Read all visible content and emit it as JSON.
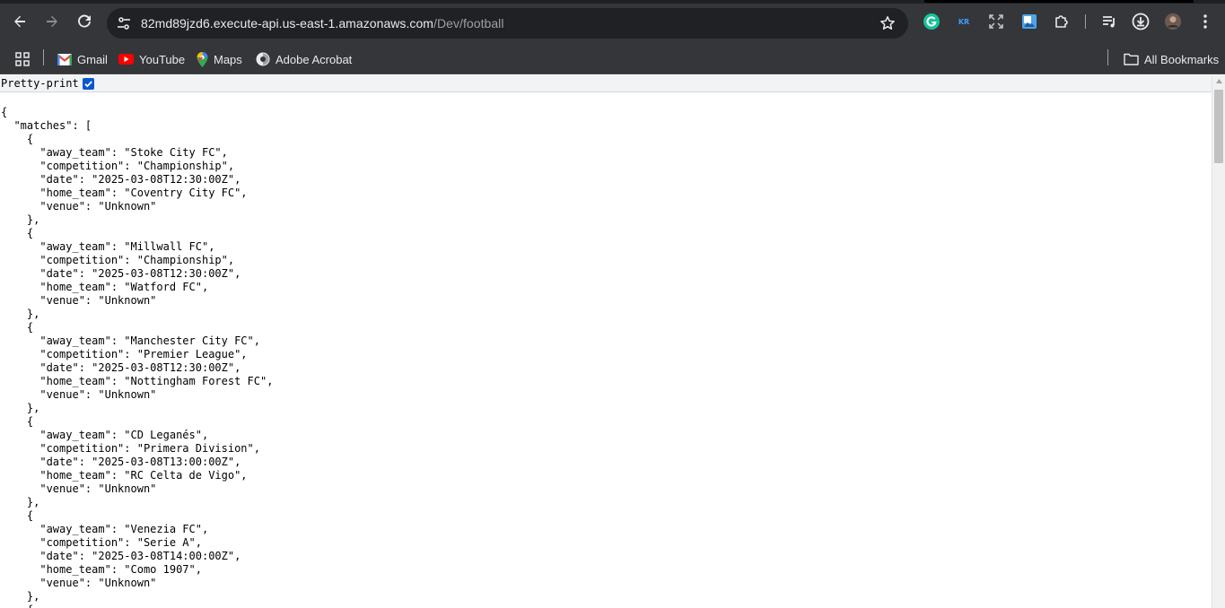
{
  "browser": {
    "url_host": "82md89jzd6.execute-api.us-east-1.amazonaws.com",
    "url_path": "/Dev/football",
    "icons": {
      "back": "arrow-left-icon",
      "forward": "arrow-right-icon",
      "reload": "reload-icon",
      "site_info": "tune-icon",
      "bookmark": "star-icon",
      "grammarly": "grammarly-icon",
      "kr_extension": "kr-icon",
      "fullscreen": "fullscreen-icon",
      "image_extension": "image-extension-icon",
      "extensions": "puzzle-icon",
      "media": "playlist-icon",
      "downloads": "download-icon",
      "profile": "avatar",
      "menu": "kebab-menu-icon"
    },
    "kr_label": "KR"
  },
  "bookmarks": {
    "items": [
      {
        "label": "Gmail",
        "icon": "gmail-icon"
      },
      {
        "label": "YouTube",
        "icon": "youtube-icon"
      },
      {
        "label": "Maps",
        "icon": "maps-icon"
      },
      {
        "label": "Adobe Acrobat",
        "icon": "adobe-acrobat-icon"
      }
    ],
    "all_bookmarks": "All Bookmarks",
    "apps_icon": "apps-grid-icon",
    "folder_icon": "folder-icon"
  },
  "page": {
    "pretty_print_label": "Pretty-print",
    "pretty_print_checked": true,
    "json_lines": [
      "{",
      "  \"matches\": [",
      "    {",
      "      \"away_team\": \"Stoke City FC\",",
      "      \"competition\": \"Championship\",",
      "      \"date\": \"2025-03-08T12:30:00Z\",",
      "      \"home_team\": \"Coventry City FC\",",
      "      \"venue\": \"Unknown\"",
      "    },",
      "    {",
      "      \"away_team\": \"Millwall FC\",",
      "      \"competition\": \"Championship\",",
      "      \"date\": \"2025-03-08T12:30:00Z\",",
      "      \"home_team\": \"Watford FC\",",
      "      \"venue\": \"Unknown\"",
      "    },",
      "    {",
      "      \"away_team\": \"Manchester City FC\",",
      "      \"competition\": \"Premier League\",",
      "      \"date\": \"2025-03-08T12:30:00Z\",",
      "      \"home_team\": \"Nottingham Forest FC\",",
      "      \"venue\": \"Unknown\"",
      "    },",
      "    {",
      "      \"away_team\": \"CD Leganés\",",
      "      \"competition\": \"Primera Division\",",
      "      \"date\": \"2025-03-08T13:00:00Z\",",
      "      \"home_team\": \"RC Celta de Vigo\",",
      "      \"venue\": \"Unknown\"",
      "    },",
      "    {",
      "      \"away_team\": \"Venezia FC\",",
      "      \"competition\": \"Serie A\",",
      "      \"date\": \"2025-03-08T14:00:00Z\",",
      "      \"home_team\": \"Como 1907\",",
      "      \"venue\": \"Unknown\"",
      "    },",
      "    {"
    ]
  },
  "colors": {
    "chrome_bg": "#35363a",
    "omnibox_bg": "#202124",
    "checkbox_blue": "#0b57d0"
  }
}
